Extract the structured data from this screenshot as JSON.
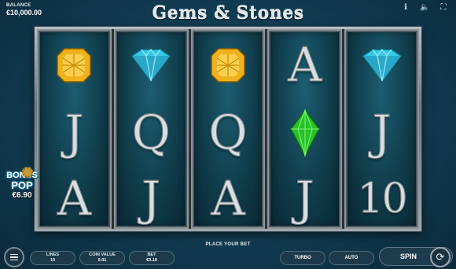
{
  "header": {
    "balance_label": "BALANCE",
    "balance_value": "€10,000.00",
    "title": "Gems & Stones",
    "icons": [
      "info-icon",
      "sound-icon",
      "fullscreen-icon"
    ]
  },
  "reels": [
    [
      "gem-yellow",
      "J",
      "A"
    ],
    [
      "gem-blue",
      "Q",
      "J"
    ],
    [
      "gem-yellow",
      "Q",
      "A"
    ],
    [
      "A",
      "gem-green",
      "J"
    ],
    [
      "gem-blue",
      "J",
      "10"
    ]
  ],
  "bonus": {
    "line1": "BONUS",
    "line2": "POP",
    "amount": "€6.90"
  },
  "status": "PLACE YOUR BET",
  "controls": {
    "lines_label": "LINES",
    "lines_value": "10",
    "coin_label": "COIN VALUE",
    "coin_value": "0.01",
    "bet_label": "BET",
    "bet_value": "€0.10",
    "turbo": "TURBO",
    "auto": "AUTO",
    "spin": "SPIN"
  },
  "colors": {
    "background": "#123f55",
    "gem_yellow": "#f0b21c",
    "gem_blue": "#38c9e8",
    "gem_green": "#27c22b"
  }
}
